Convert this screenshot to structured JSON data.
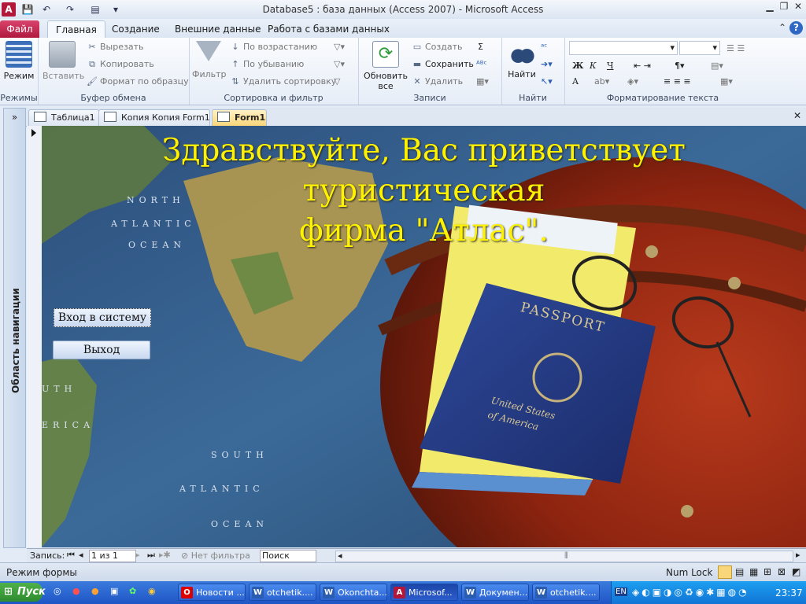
{
  "window": {
    "title": "Database5 : база данных (Access 2007)  -  Microsoft Access"
  },
  "ribbon": {
    "tabs": [
      "Файл",
      "Главная",
      "Создание",
      "Внешние данные",
      "Работа с базами данных"
    ],
    "groups": {
      "modes": {
        "label": "Режимы",
        "mode_button": "Режим"
      },
      "clipboard": {
        "label": "Буфер обмена",
        "paste": "Вставить",
        "cut": "Вырезать",
        "copy": "Копировать",
        "format_painter": "Формат по образцу"
      },
      "sort_filter": {
        "label": "Сортировка и фильтр",
        "filter": "Фильтр",
        "ascending": "По возрастанию",
        "descending": "По убыванию",
        "remove_sort": "Удалить сортировку"
      },
      "records": {
        "label": "Записи",
        "refresh_line1": "Обновить",
        "refresh_line2": "все",
        "new": "Создать",
        "save": "Сохранить",
        "delete": "Удалить"
      },
      "find": {
        "label": "Найти",
        "find_button": "Найти"
      },
      "text_formatting": {
        "label": "Форматирование текста",
        "bold": "Ж",
        "italic": "К",
        "underline": "Ч",
        "font_color": "A"
      }
    }
  },
  "nav_pane": {
    "label": "Область навигации"
  },
  "doc_tabs": [
    {
      "label": "Таблица1"
    },
    {
      "label": "Копия Копия Form1"
    },
    {
      "label": "Form1"
    }
  ],
  "form": {
    "headline_line1": "Здравствуйте, Вас приветствует туристическая",
    "headline_line2": "фирма \"Атлас\".",
    "login_button": "Вход в систему",
    "exit_button": "Выход",
    "passport_title": "PASSPORT",
    "passport_sub1": "United States",
    "passport_sub2": "of America",
    "map_labels": [
      "NORTH",
      "ATLANTIC",
      "OCEAN",
      "SOUTH",
      "ATLANTIC",
      "OCEAN",
      "UTH",
      "ERICA"
    ]
  },
  "record_nav": {
    "label": "Запись:",
    "position": "1 из 1",
    "filter": "Нет фильтра",
    "search_placeholder": "Поиск"
  },
  "status": {
    "mode": "Режим формы",
    "numlock": "Num Lock"
  },
  "taskbar": {
    "start": "Пуск",
    "buttons": [
      "Новости ...",
      "otchetik....",
      "Okonchta...",
      "Microsof...",
      "Докумен...",
      "otchetik...."
    ],
    "lang": "EN",
    "clock": "23:37"
  },
  "colors": {
    "headline": "#fff200",
    "file_tab": "#c0284d",
    "taskbar": "#245edc"
  }
}
